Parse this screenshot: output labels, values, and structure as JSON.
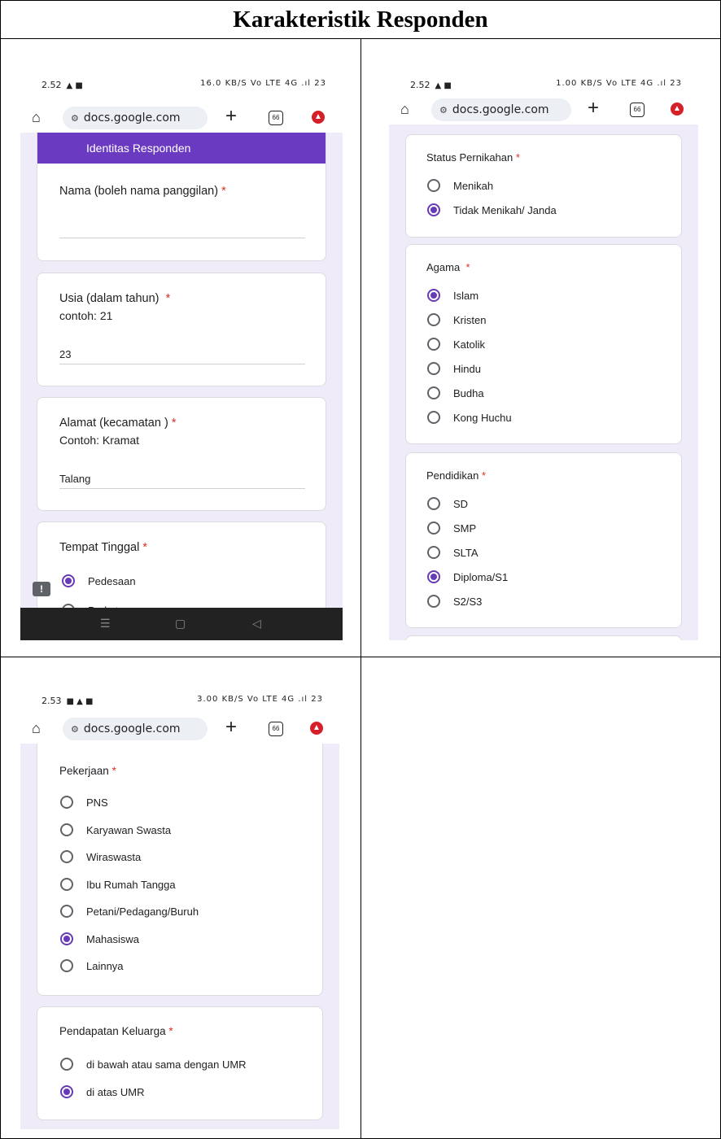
{
  "title": "Karakteristik Responden",
  "screen1": {
    "status_time": "2.52",
    "status_icons": "16.0 KB/S  Vo LTE 4G .ıl  23",
    "url": "docs.google.com",
    "tabs_count": "66",
    "section_header": "Identitas Responden",
    "q_nama": "Nama (boleh nama panggilan)",
    "q_usia": "Usia (dalam tahun)",
    "hint_usia": "contoh:  21",
    "ans_usia": "23",
    "q_alamat": "Alamat (kecamatan )",
    "hint_alamat": "Contoh: Kramat",
    "ans_alamat": "Talang",
    "q_tempat": "Tempat Tinggal",
    "opt_pedesaan": "Pedesaan",
    "opt_perkotaan": "Perkotaan",
    "required_mark": "*"
  },
  "screen2": {
    "status_time": "2.52",
    "status_icons": "1.00 KB/S  Vo LTE 4G .ıl  23",
    "url": "docs.google.com",
    "tabs_count": "66",
    "q_status": "Status Pernikahan",
    "status_options": [
      "Menikah",
      "Tidak Menikah/ Janda"
    ],
    "status_selected": 1,
    "q_agama": "Agama",
    "agama_options": [
      "Islam",
      "Kristen",
      "Katolik",
      "Hindu",
      "Budha",
      "Kong Huchu"
    ],
    "agama_selected": 0,
    "q_pendidikan": "Pendidikan",
    "pendidikan_options": [
      "SD",
      "SMP",
      "SLTA",
      "Diploma/S1",
      "S2/S3"
    ],
    "pendidikan_selected": 3,
    "required_mark": "*"
  },
  "screen3": {
    "status_time": "2.53",
    "status_icons": "3.00 KB/S  Vo LTE 4G .ıl  23",
    "url": "docs.google.com",
    "tabs_count": "66",
    "q_pekerjaan": "Pekerjaan",
    "pekerjaan_options": [
      "PNS",
      "Karyawan Swasta",
      "Wiraswasta",
      "Ibu Rumah Tangga",
      "Petani/Pedagang/Buruh",
      "Mahasiswa",
      "Lainnya"
    ],
    "pekerjaan_selected": 5,
    "q_pendapatan": "Pendapatan Keluarga",
    "pendapatan_options": [
      "di bawah atau sama dengan UMR",
      "di atas UMR"
    ],
    "pendapatan_selected": 1,
    "required_mark": "*"
  }
}
